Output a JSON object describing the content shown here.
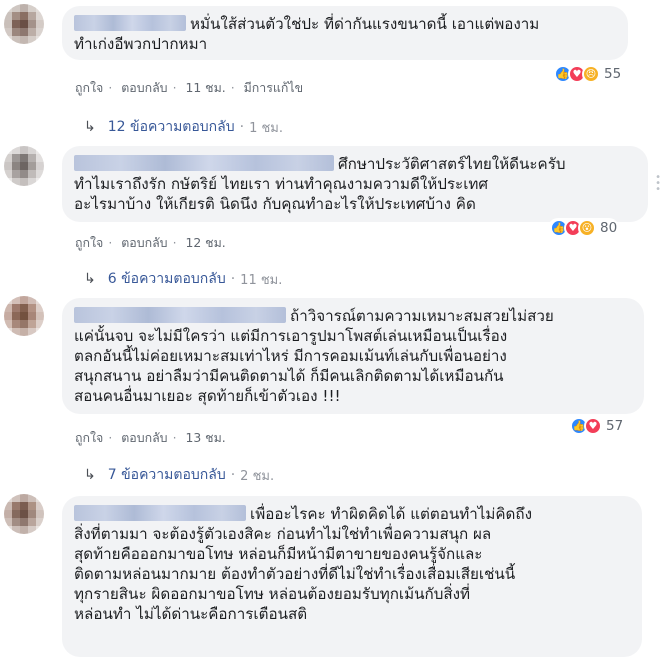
{
  "comments": [
    {
      "lines": [
        "หมั่นใส้ส่วนตัวใช่ปะ ที่ด่ากันแรงขนาดนี้ เอาแต่พองาม",
        "ทำเก่งอีพวกปากหมา"
      ],
      "actions": {
        "like": "ถูกใจ",
        "reply": "ตอบกลับ",
        "time": "11 ชม.",
        "edited": "มีการแก้ไข"
      },
      "reaction_count": "55",
      "reactions": [
        "like-icon",
        "love-icon",
        "angry-icon"
      ],
      "replies": {
        "label": "12 ข้อความตอบกลับ",
        "time": "1 ชม."
      }
    },
    {
      "lines": [
        "ศึกษาประวัติศาสตร์ไทยให้ดีนะครับ",
        "ทำไมเราถึงรัก กษัตริย์ ไทยเรา ท่านทำคุณงามความดีให้ประเทศ",
        "อะไรมาบ้าง ให้เกียรติ นิดนึง กับคุณทำอะไรให้ประเทศบ้าง คิด"
      ],
      "actions": {
        "like": "ถูกใจ",
        "reply": "ตอบกลับ",
        "time": "12 ชม."
      },
      "reaction_count": "80",
      "reactions": [
        "like-icon",
        "love-icon",
        "wow-icon"
      ],
      "replies": {
        "label": "6 ข้อความตอบกลับ",
        "time": "11 ชม."
      }
    },
    {
      "lines": [
        "ถ้าวิจารณ์ตามความเหมาะสมสวยไม่สวย",
        "แค่นั้นจบ จะไม่มีใครว่า แต่มีการเอารูปมาโพสต์เล่นเหมือนเป็นเรื่อง",
        "ตลกอันนี้ไม่ค่อยเหมาะสมเท่าไหร่ มีการคอมเม้นท์เล่นกับเพื่อนอย่าง",
        "สนุกสนาน อย่าลืมว่ามีคนติดตามได้ ก็มีคนเลิกติดตามได้เหมือนกัน",
        "สอนคนอื่นมาเยอะ สุดท้ายก็เข้าตัวเอง !!!"
      ],
      "actions": {
        "like": "ถูกใจ",
        "reply": "ตอบกลับ",
        "time": "13 ชม."
      },
      "reaction_count": "57",
      "reactions": [
        "like-icon",
        "love-icon"
      ],
      "replies": {
        "label": "7 ข้อความตอบกลับ",
        "time": "2 ชม."
      }
    },
    {
      "lines": [
        "เพื่ออะไรคะ ทำผิดคิดได้ แต่ตอนทำไม่คิดถึง",
        "สิ่งที่ตามมา จะต้องรู้ตัวเองสิคะ ก่อนทำไม่ใช่ทำเพื่อความสนุก ผล",
        "สุดท้ายคือออกมาขอโทษ หล่อนก็มีหน้ามีตาขายของคนรู้จักและ",
        "ติดตามหล่อนมากมาย ต้องทำตัวอย่างที่ดีไม่ใช่ทำเรื่องเสื่อมเสียเช่นนี้",
        "ทุกรายสินะ ผิดออกมาขอโทษ หล่อนต้องยอมรับทุกเม้นกับสิ่งที่",
        "หล่อนทำ ไม่ได้ด่านะคือการเตือนสติ"
      ]
    }
  ],
  "colors": {
    "like": "#2d88ff",
    "love": "#f33e58",
    "angry": "#f7b125",
    "link": "#385898",
    "bubble": "#f2f3f5"
  }
}
